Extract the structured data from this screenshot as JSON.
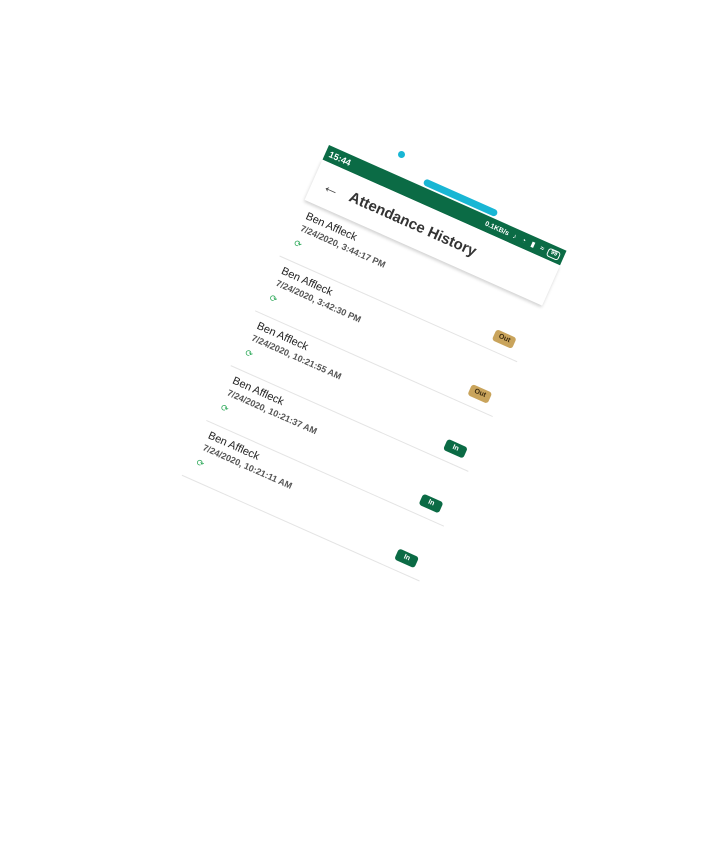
{
  "status_bar": {
    "time": "15:44",
    "network_speed": "0.1KB/s",
    "battery": "99",
    "background_color": "#0b6b45"
  },
  "toolbar": {
    "back_icon": "back-arrow-icon",
    "title": "Attendance History"
  },
  "attendance": [
    {
      "name": "Ben Affleck",
      "time": "7/24/2020, 3:44:17 PM",
      "type": "Out"
    },
    {
      "name": "Ben Affleck",
      "time": "7/24/2020, 3:42:30 PM",
      "type": "Out"
    },
    {
      "name": "Ben Affleck",
      "time": "7/24/2020, 10:21:55 AM",
      "type": "In"
    },
    {
      "name": "Ben Affleck",
      "time": "7/24/2020, 10:21:37 AM",
      "type": "In"
    },
    {
      "name": "Ben Affleck",
      "time": "7/24/2020, 10:21:11 AM",
      "type": "In"
    }
  ],
  "colors": {
    "accent": "#0b6b45",
    "out_badge": "#c9a45c",
    "sync_icon": "#2ea95a",
    "decor_cyan": "#19b6d4"
  }
}
